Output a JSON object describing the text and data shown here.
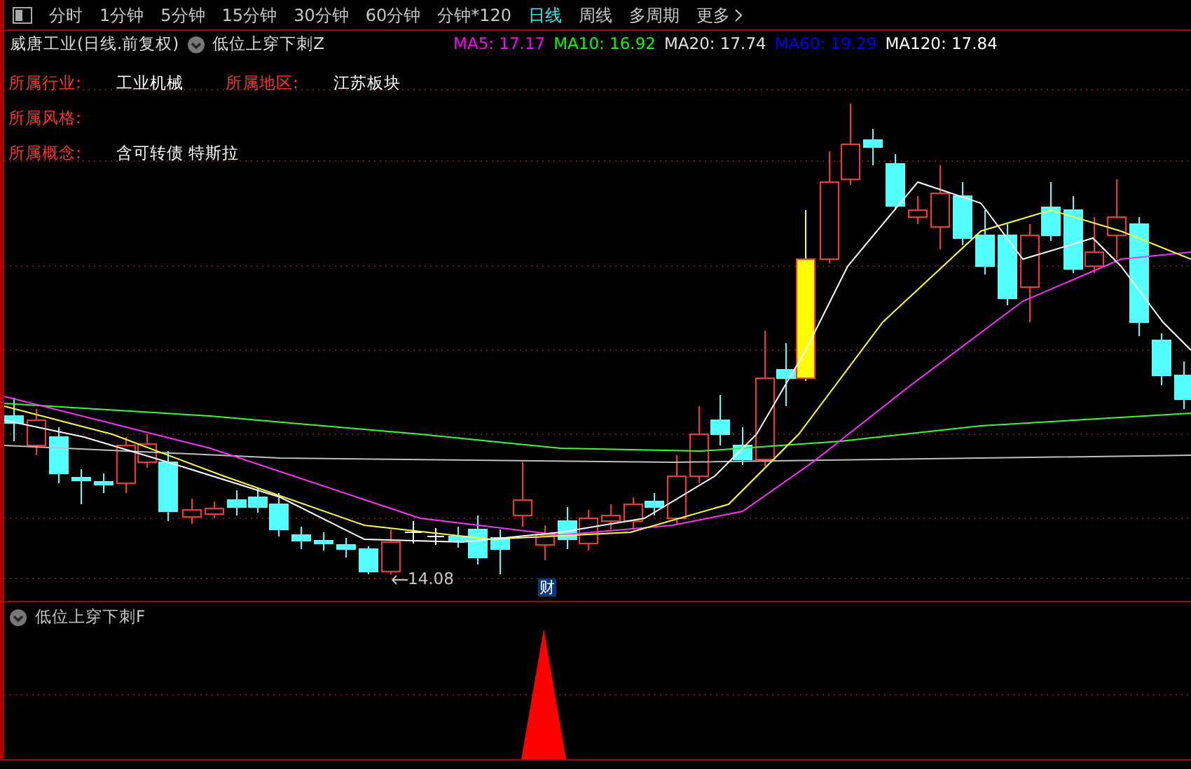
{
  "toolbar": {
    "tabs": [
      {
        "label": "分时",
        "selected": false
      },
      {
        "label": "1分钟",
        "selected": false
      },
      {
        "label": "5分钟",
        "selected": false
      },
      {
        "label": "15分钟",
        "selected": false
      },
      {
        "label": "30分钟",
        "selected": false
      },
      {
        "label": "60分钟",
        "selected": false
      },
      {
        "label": "分钟*120",
        "selected": false
      },
      {
        "label": "日线",
        "selected": true
      },
      {
        "label": "周线",
        "selected": false
      },
      {
        "label": "多周期",
        "selected": false
      },
      {
        "label": "更多",
        "selected": false
      }
    ]
  },
  "chart_header": {
    "title": "威唐工业(日线.前复权)",
    "indicator": "低位上穿下刺Z",
    "moving_averages": [
      {
        "label": "MA5:",
        "value": "17.17",
        "color": "#ff00ff"
      },
      {
        "label": "MA10:",
        "value": "16.92",
        "color": "#00ff00"
      },
      {
        "label": "MA20:",
        "value": "17.74",
        "color": "#e0e0e0"
      },
      {
        "label": "MA60:",
        "value": "19.29",
        "color": "#0000ff"
      },
      {
        "label": "MA120:",
        "value": "17.84",
        "color": "#ffffff"
      }
    ]
  },
  "info": [
    {
      "label": "所属行业:",
      "value": "工业机械"
    },
    {
      "label": "所属地区:",
      "value": "江苏板块"
    },
    {
      "label": "所属风格:"
    },
    {
      "label": "所属概念:",
      "value": "含可转债 特斯拉"
    }
  ],
  "price_marker": "14.08",
  "event_badge": "财",
  "lower_panel": {
    "title": "低位上穿下刺F"
  }
}
